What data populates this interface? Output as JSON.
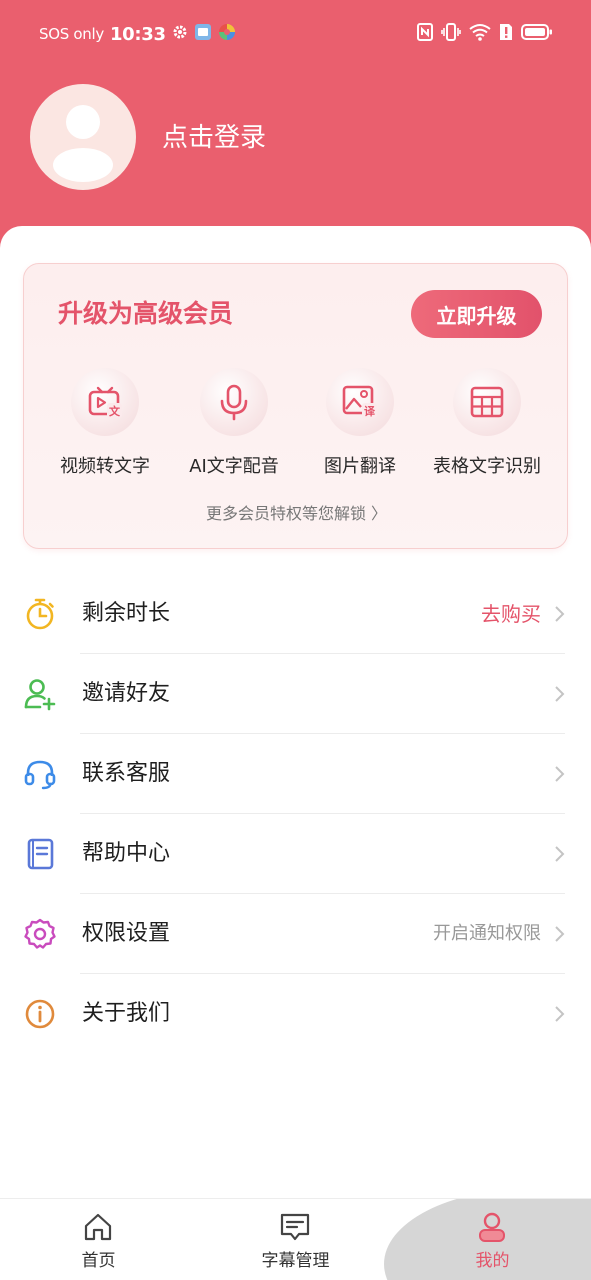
{
  "status_bar": {
    "carrier": "SOS only",
    "time": "10:33"
  },
  "profile": {
    "login_label": "点击登录"
  },
  "vip_card": {
    "title": "升级为高级会员",
    "upgrade_button": "立即升级",
    "features": [
      {
        "label": "视频转文字",
        "icon": "video-to-text-icon"
      },
      {
        "label": "AI文字配音",
        "icon": "microphone-icon"
      },
      {
        "label": "图片翻译",
        "icon": "image-translate-icon"
      },
      {
        "label": "表格文字识别",
        "icon": "table-icon"
      }
    ],
    "more_perks": "更多会员特权等您解锁 〉"
  },
  "menu": [
    {
      "label": "剩余时长",
      "right_text": "去购买",
      "icon": "stopwatch-icon",
      "icon_color": "#f2b622"
    },
    {
      "label": "邀请好友",
      "right_text": "",
      "icon": "add-user-icon",
      "icon_color": "#4cbc53"
    },
    {
      "label": "联系客服",
      "right_text": "",
      "icon": "headset-icon",
      "icon_color": "#3d8be8"
    },
    {
      "label": "帮助中心",
      "right_text": "",
      "icon": "book-icon",
      "icon_color": "#5a78d8"
    },
    {
      "label": "权限设置",
      "right_text": "开启通知权限",
      "icon": "gear-icon",
      "icon_color": "#c94bbd"
    },
    {
      "label": "关于我们",
      "right_text": "",
      "icon": "info-icon",
      "icon_color": "#e08a3c"
    }
  ],
  "tabbar": [
    {
      "label": "首页",
      "icon": "home-icon"
    },
    {
      "label": "字幕管理",
      "icon": "subtitle-icon"
    },
    {
      "label": "我的",
      "icon": "profile-icon"
    }
  ],
  "colors": {
    "brand": "#ea5f6e",
    "accent_text": "#e4546a",
    "muted_text": "#999999"
  }
}
